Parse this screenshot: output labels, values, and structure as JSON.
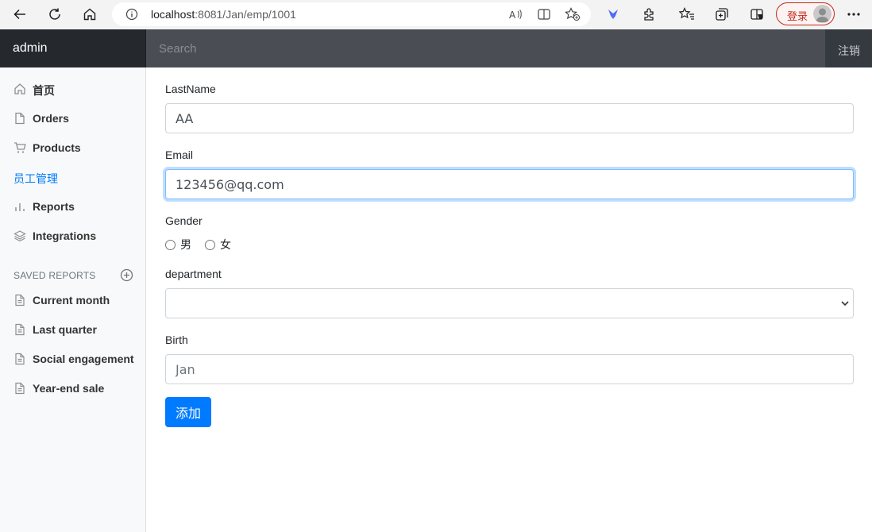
{
  "browser": {
    "url_host": "localhost",
    "url_path": ":8081/Jan/emp/1001",
    "login_label": "登录"
  },
  "navbar": {
    "brand": "admin",
    "search_placeholder": "Search",
    "signout": "注销"
  },
  "sidebar": {
    "items": [
      {
        "label": "首页",
        "icon": "home-icon"
      },
      {
        "label": "Orders",
        "icon": "file-icon"
      },
      {
        "label": "Products",
        "icon": "cart-icon"
      },
      {
        "label": "员工管理",
        "active": true
      },
      {
        "label": "Reports",
        "icon": "bar-chart-icon"
      },
      {
        "label": "Integrations",
        "icon": "layers-icon"
      }
    ],
    "saved_heading": "SAVED REPORTS",
    "saved": [
      {
        "label": "Current month",
        "icon": "file-text-icon"
      },
      {
        "label": "Last quarter",
        "icon": "file-text-icon"
      },
      {
        "label": "Social engagement",
        "icon": "file-text-icon"
      },
      {
        "label": "Year-end sale",
        "icon": "file-text-icon"
      }
    ]
  },
  "form": {
    "lastname_label": "LastName",
    "lastname_value": "AA",
    "email_label": "Email",
    "email_value": "123456@qq.com",
    "gender_label": "Gender",
    "gender_options": [
      "男",
      "女"
    ],
    "department_label": "department",
    "department_value": "",
    "birth_label": "Birth",
    "birth_placeholder": "Jan",
    "submit_label": "添加"
  },
  "colors": {
    "accent": "#007bff",
    "navbar": "#343a40",
    "sidebar": "#f8f9fa"
  }
}
